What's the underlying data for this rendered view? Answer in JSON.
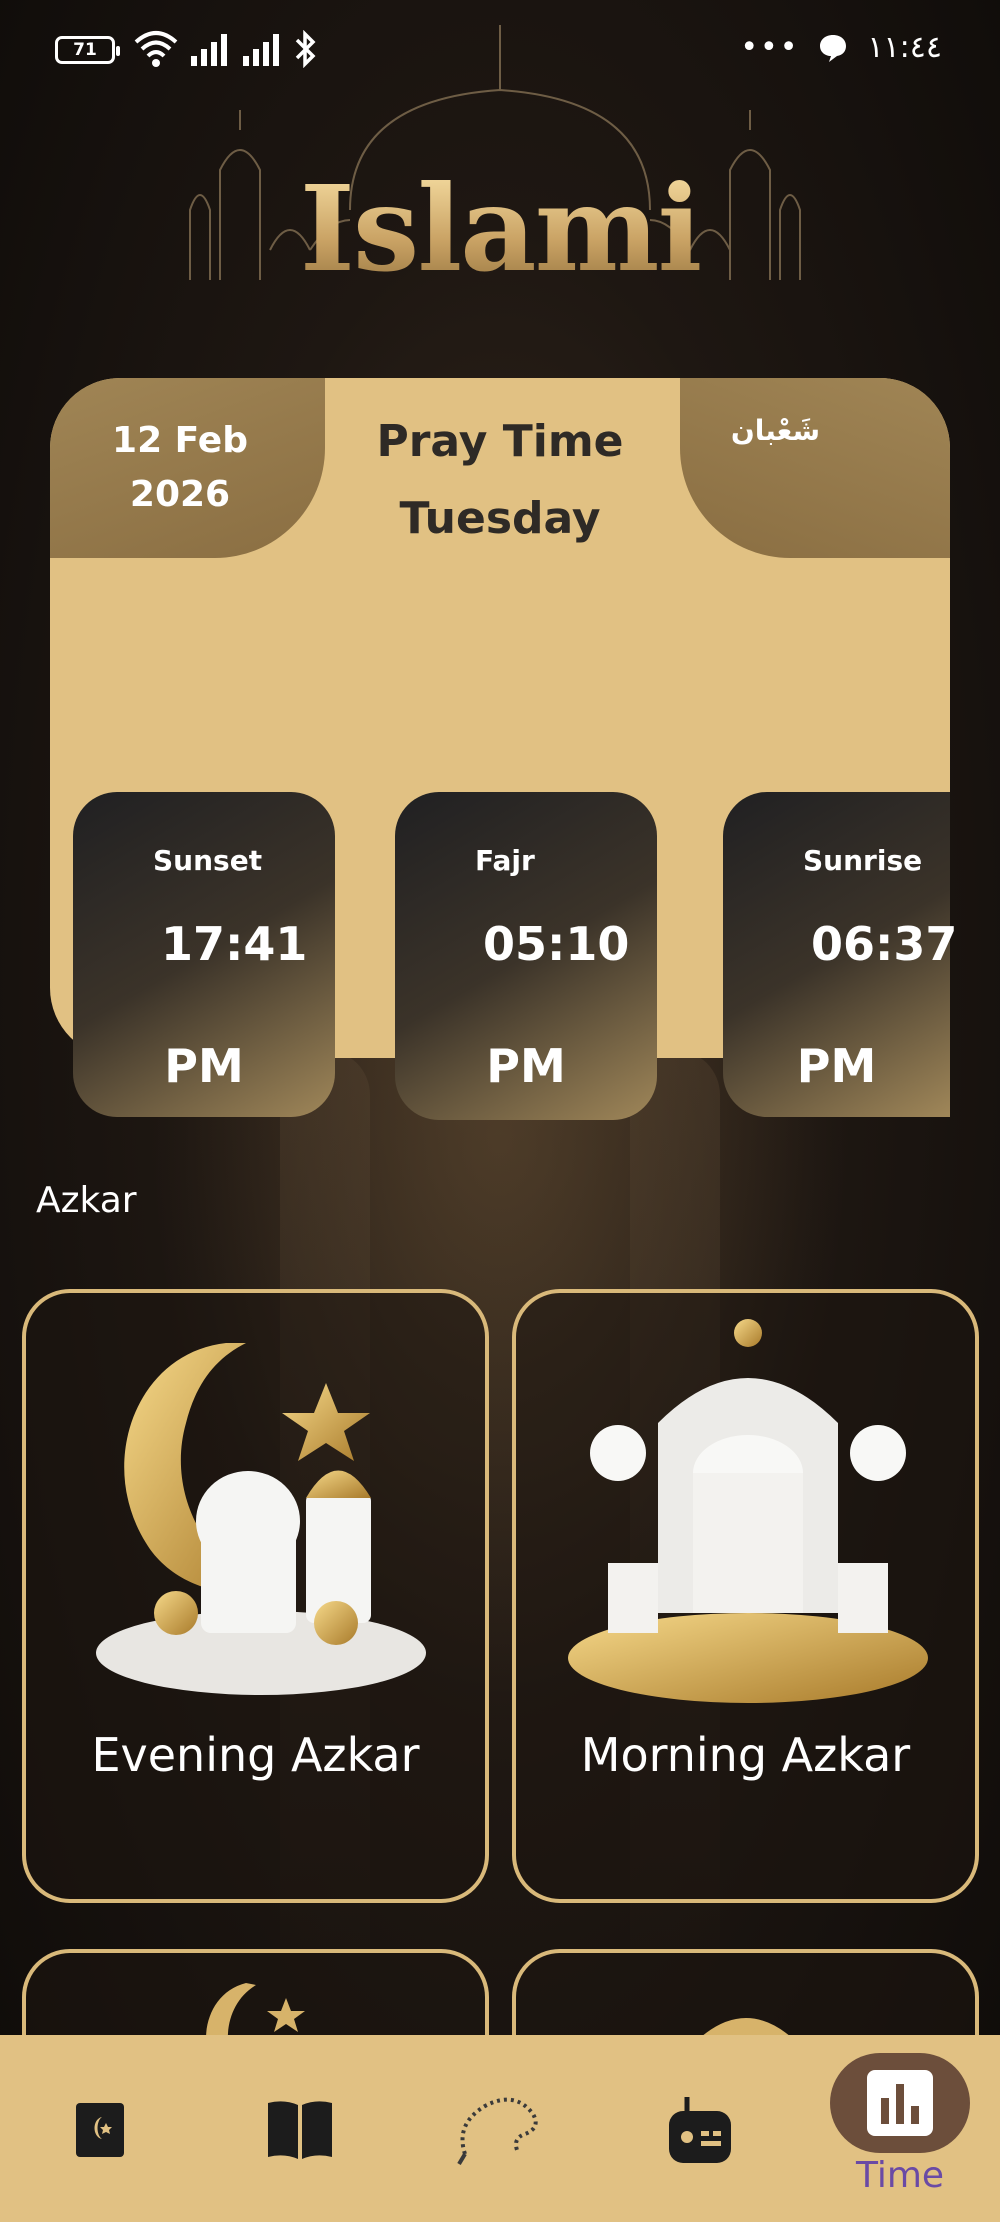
{
  "status_bar": {
    "battery": "71",
    "clock": "١١:٤٤"
  },
  "header": {
    "logo_text": "Islami"
  },
  "prayer_card": {
    "date": "12 Feb\n2026",
    "title": "Pray Time",
    "day": "Tuesday",
    "hijri_month": "شَعْبان",
    "times": [
      {
        "name": "Sunset",
        "time": "17:41",
        "period": "PM"
      },
      {
        "name": "Fajr",
        "time": "05:10",
        "period": "PM"
      },
      {
        "name": "Sunrise",
        "time": "06:37",
        "period": "PM"
      }
    ]
  },
  "azkar": {
    "section_title": "Azkar",
    "cards": [
      {
        "label": "Evening Azkar"
      },
      {
        "label": "Morning Azkar"
      }
    ]
  },
  "bottom_nav": {
    "items": [
      "quran-icon",
      "hadith-icon",
      "sebha-icon",
      "radio-icon",
      "time-icon"
    ],
    "active_label": "Time"
  },
  "colors": {
    "accent": "#e1c183",
    "card_border": "#d9b97a",
    "active_nav": "#6c4e3b",
    "active_label": "#6a4aa5"
  }
}
